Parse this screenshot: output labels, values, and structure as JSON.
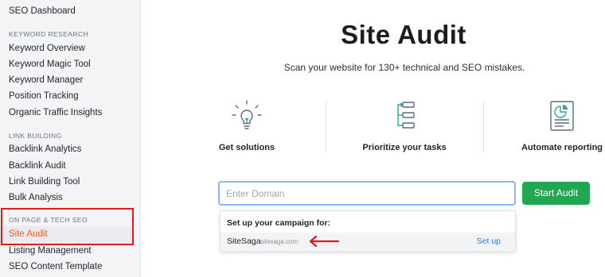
{
  "sidebar": {
    "dashboard": "SEO Dashboard",
    "sections": [
      {
        "title": "KEYWORD RESEARCH",
        "items": [
          "Keyword Overview",
          "Keyword Magic Tool",
          "Keyword Manager",
          "Position Tracking",
          "Organic Traffic Insights"
        ]
      },
      {
        "title": "LINK BUILDING",
        "items": [
          "Backlink Analytics",
          "Backlink Audit",
          "Link Building Tool",
          "Bulk Analysis"
        ]
      },
      {
        "title": "ON PAGE & TECH SEO",
        "items": [
          "Site Audit",
          "Listing Management",
          "SEO Content Template"
        ]
      }
    ],
    "active_item": "Site Audit"
  },
  "main": {
    "title": "Site Audit",
    "subtitle": "Scan your website for 130+ technical and SEO mistakes.",
    "features": [
      {
        "label": "Get solutions",
        "icon": "lightbulb-icon"
      },
      {
        "label": "Prioritize your tasks",
        "icon": "flowchart-icon"
      },
      {
        "label": "Automate reporting",
        "icon": "report-icon"
      }
    ],
    "domain_input": {
      "placeholder": "Enter Domain",
      "value": ""
    },
    "start_button": "Start Audit",
    "dropdown": {
      "header": "Set up your campaign for:",
      "project_name": "SiteSaga",
      "project_domain": "sitesaga.com",
      "action": "Set up"
    }
  },
  "colors": {
    "accent_orange": "#ff5b23",
    "highlight_red": "#e0191b",
    "button_green": "#21a750",
    "link_blue": "#2a7de1"
  }
}
